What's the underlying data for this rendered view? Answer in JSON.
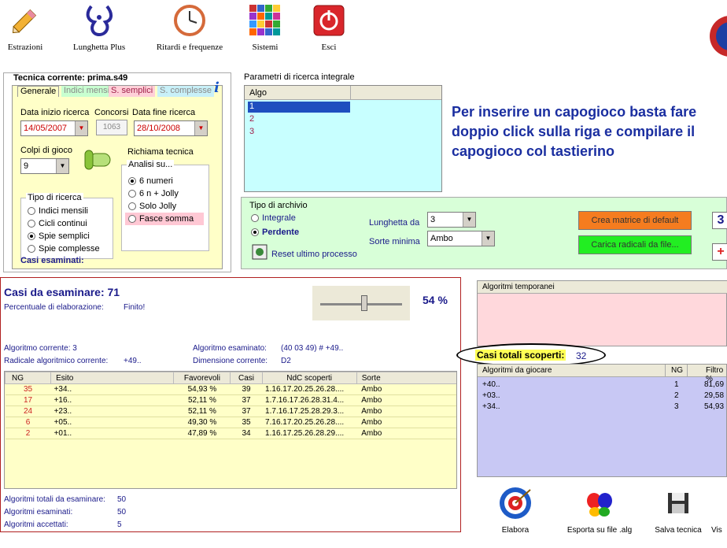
{
  "toolbar": [
    {
      "label": "Estrazioni",
      "icon": "pencil-icon"
    },
    {
      "label": "Lunghetta Plus",
      "icon": "lottery-hand-icon"
    },
    {
      "label": "Ritardi e frequenze",
      "icon": "clock-icon"
    },
    {
      "label": "Sistemi",
      "icon": "grid-icon"
    },
    {
      "label": "Esci",
      "icon": "power-icon"
    }
  ],
  "tecnica": {
    "title": "Tecnica corrente: prima.s49",
    "tabs": [
      "Generale",
      "Indici mensili",
      "S. semplici",
      "S. complesse"
    ],
    "data_inizio_label": "Data inizio ricerca",
    "data_inizio": "14/05/2007",
    "concorsi_label": "Concorsi",
    "concorsi": "1063",
    "data_fine_label": "Data fine ricerca",
    "data_fine": "28/10/2008",
    "colpi_label": "Colpi di gioco",
    "colpi": "9",
    "richiama": "Richiama tecnica",
    "tipo_ricerca_label": "Tipo di ricerca",
    "tipo_ricerca": [
      "Indici mensili",
      "Cicli continui",
      "Spie semplici",
      "Spie complesse"
    ],
    "analisi_label": "Analisi su...",
    "analisi": [
      "6 numeri",
      "6 n + Jolly",
      "Solo Jolly",
      "Fasce somma"
    ],
    "casi_esaminati": "Casi esaminati:"
  },
  "parametri": {
    "title": "Parametri di ricerca integrale",
    "col": "Algo",
    "rows": [
      "1",
      "2",
      "3"
    ],
    "info": "Per inserire un capogioco basta fare doppio click sulla riga e compilare il capogioco col tastierino"
  },
  "archivio": {
    "label": "Tipo di archivio",
    "opts": [
      "Integrale",
      "Perdente"
    ],
    "lunghetta_label": "Lunghetta da",
    "lunghetta": "3",
    "sorte_label": "Sorte minima",
    "sorte": "Ambo",
    "reset": "Reset ultimo processo",
    "crea": "Crea matrice di default",
    "carica": "Carica radicali da file...",
    "num": "3",
    "plus": "+"
  },
  "casi": {
    "title": "Casi da esaminare: 71",
    "perc_label": "Percentuale di elaborazione:",
    "perc_status": "Finito!",
    "percent": "54 %",
    "algo_corrente": "Algoritmo corrente: 3",
    "radicale": "Radicale algoritmico corrente:",
    "radicale_val": "+49..",
    "algo_esaminato": "Algoritmo esaminato:",
    "algo_esaminato_val": "(40 03 49) # +49..",
    "dimensione": "Dimensione corrente:",
    "dimensione_val": "D2",
    "headers": [
      "NG",
      "Esito",
      "Favorevoli",
      "Casi",
      "NdC scoperti",
      "Sorte"
    ],
    "rows": [
      [
        "35",
        "+34..",
        "54,93 %",
        "39",
        "1.16.17.20.25.26.28....",
        "Ambo"
      ],
      [
        "17",
        "+16..",
        "52,11 %",
        "37",
        "1.7.16.17.26.28.31.4...",
        "Ambo"
      ],
      [
        "24",
        "+23..",
        "52,11 %",
        "37",
        "1.7.16.17.25.28.29.3...",
        "Ambo"
      ],
      [
        "6",
        "+05..",
        "49,30 %",
        "35",
        "7.16.17.20.25.26.28....",
        "Ambo"
      ],
      [
        "2",
        "+01..",
        "47,89 %",
        "34",
        "1.16.17.25.26.28.29....",
        "Ambo"
      ]
    ],
    "totali": [
      [
        "Algoritmi totali da esaminare:",
        "50"
      ],
      [
        "Algoritmi esaminati:",
        "50"
      ],
      [
        "Algoritmi accettati:",
        "5"
      ]
    ]
  },
  "temp": {
    "title": "Algoritmi temporanei",
    "scoperti_label": "Casi totali scoperti:",
    "scoperti": "32",
    "giocare_headers": [
      "Algoritmi da giocare",
      "NG",
      "Filtro %"
    ],
    "giocare_rows": [
      [
        "+40..",
        "1",
        "81,69"
      ],
      [
        "+03..",
        "2",
        "29,58"
      ],
      [
        "+34..",
        "3",
        "54,93"
      ]
    ]
  },
  "bottom": [
    {
      "label": "Elabora",
      "icon": "target-icon"
    },
    {
      "label": "Esporta su file .alg",
      "icon": "butterfly-icon"
    },
    {
      "label": "Salva tecnica",
      "icon": "floppy-icon"
    },
    {
      "label": "Vis",
      "icon": "view-icon"
    }
  ]
}
